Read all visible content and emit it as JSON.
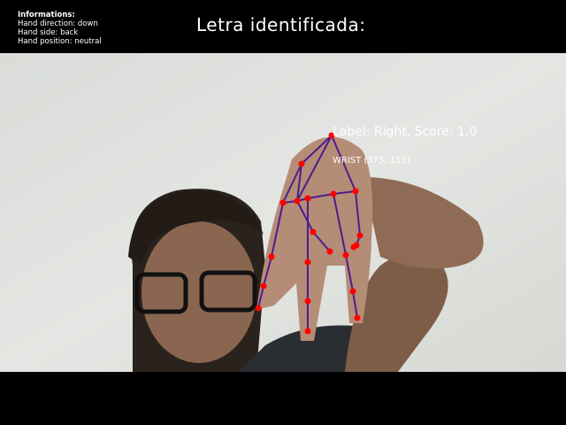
{
  "info": {
    "heading": "Informations:",
    "direction": "Hand direction: down",
    "side": "Hand side: back",
    "position": "Hand position: neutral"
  },
  "title": "Letra identificada:",
  "detection": {
    "label_text": "Label: Right, Score: 1.0",
    "wrist_text": "WRIST (375, 153)",
    "landmark_color": "#ff0000",
    "connection_color": "#4b1e8c"
  }
}
